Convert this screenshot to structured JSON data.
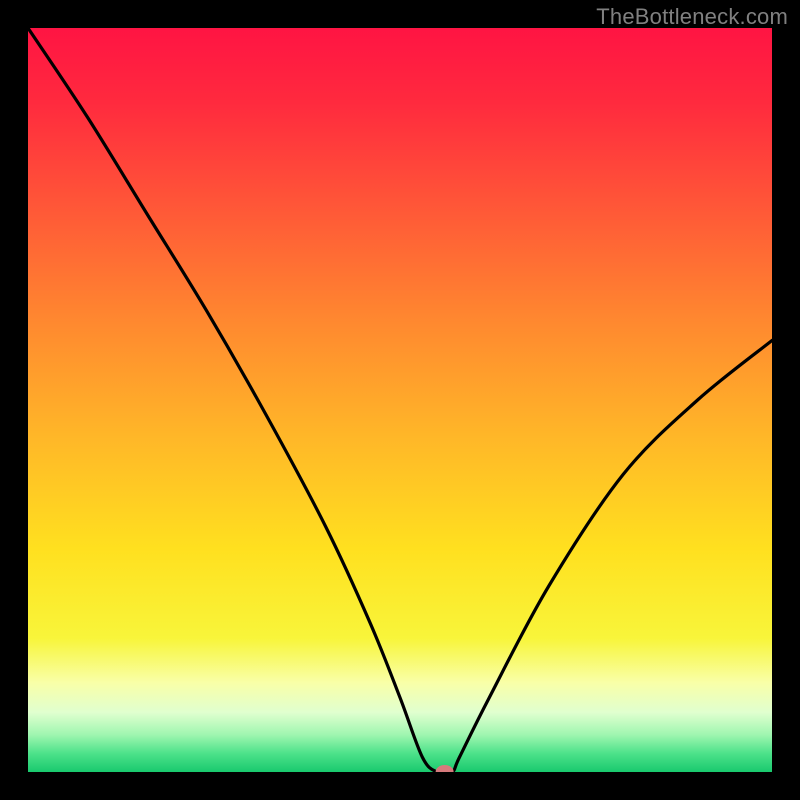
{
  "watermark": "TheBottleneck.com",
  "chart_data": {
    "type": "line",
    "title": "",
    "xlabel": "",
    "ylabel": "",
    "xlim": [
      0,
      100
    ],
    "ylim": [
      0,
      100
    ],
    "series": [
      {
        "name": "bottleneck-curve",
        "x": [
          0,
          8,
          16,
          24,
          32,
          40,
          46,
          50,
          53,
          55,
          57,
          58,
          62,
          70,
          80,
          90,
          100
        ],
        "values": [
          100,
          88,
          75,
          62,
          48,
          33,
          20,
          10,
          2,
          0,
          0,
          2,
          10,
          25,
          40,
          50,
          58
        ]
      }
    ],
    "marker": {
      "x": 56,
      "y": 0
    },
    "gradient_stops": [
      {
        "offset": 0.0,
        "color": "#ff1443"
      },
      {
        "offset": 0.1,
        "color": "#ff2a3e"
      },
      {
        "offset": 0.25,
        "color": "#ff5a37"
      },
      {
        "offset": 0.4,
        "color": "#ff8a2f"
      },
      {
        "offset": 0.55,
        "color": "#ffb728"
      },
      {
        "offset": 0.7,
        "color": "#ffe01f"
      },
      {
        "offset": 0.82,
        "color": "#f8f53a"
      },
      {
        "offset": 0.88,
        "color": "#f9ffa8"
      },
      {
        "offset": 0.92,
        "color": "#e0ffcf"
      },
      {
        "offset": 0.95,
        "color": "#9ff6b0"
      },
      {
        "offset": 0.975,
        "color": "#4de28a"
      },
      {
        "offset": 1.0,
        "color": "#19c96e"
      }
    ]
  }
}
